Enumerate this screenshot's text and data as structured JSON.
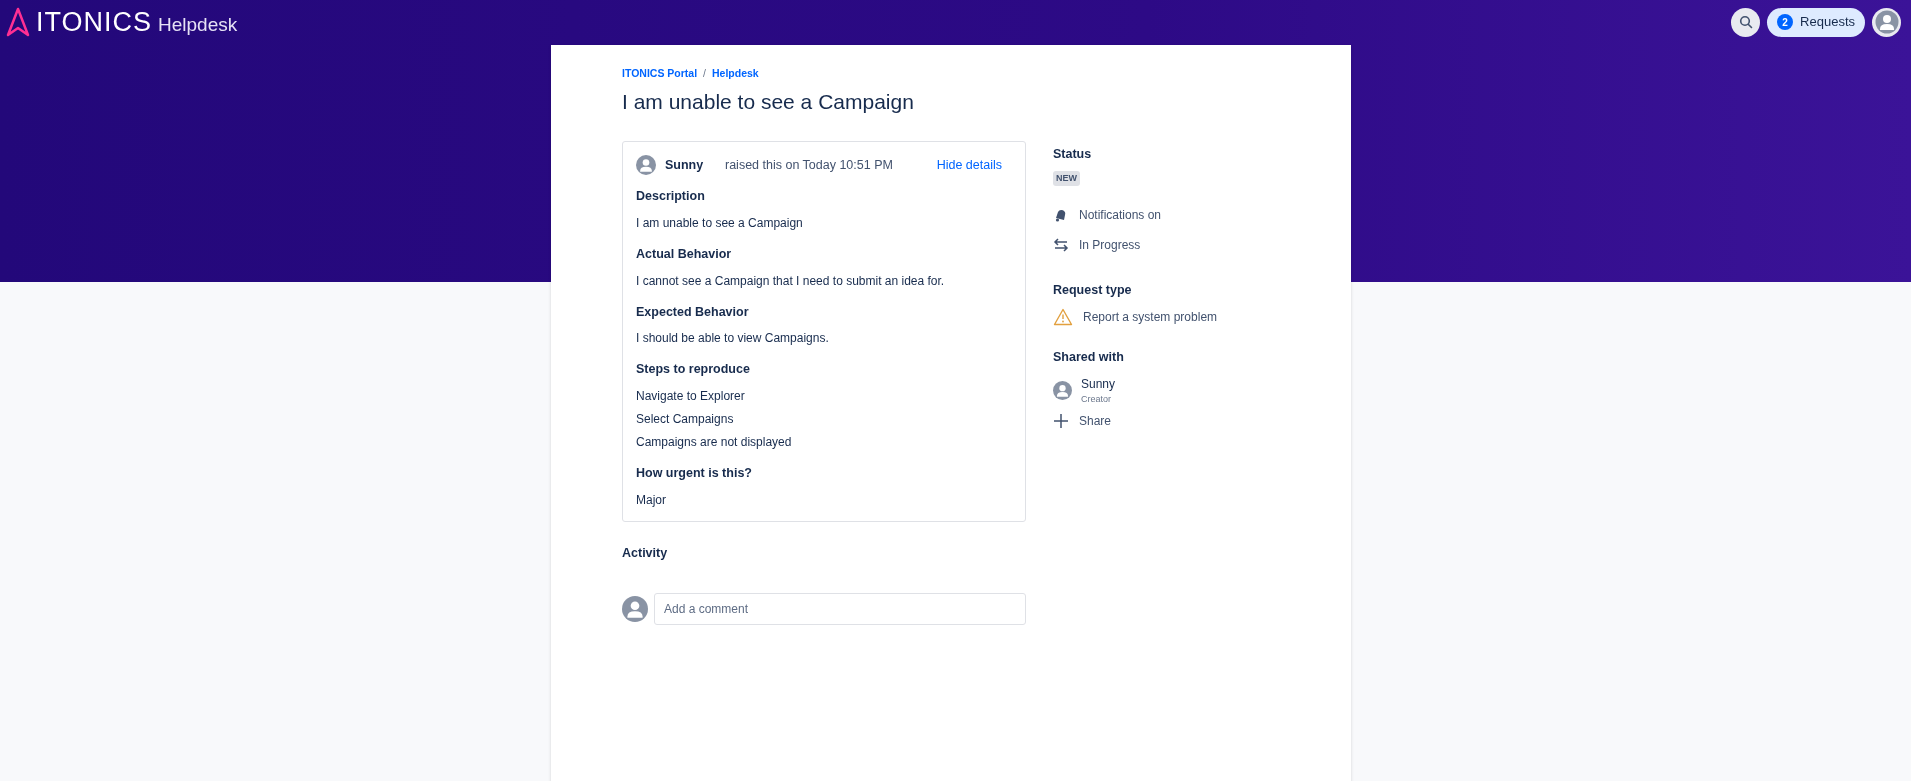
{
  "header": {
    "logo_text": "ITONICS",
    "logo_subtitle": "Helpdesk",
    "requests_count": "2",
    "requests_label": "Requests"
  },
  "breadcrumbs": [
    {
      "label": "ITONICS Portal"
    },
    {
      "label": "Helpdesk"
    }
  ],
  "breadcrumb_separator": "/",
  "title": "I am unable to see a Campaign",
  "details": {
    "author": "Sunny",
    "raised": "raised this on Today 10:51 PM",
    "toggle": "Hide details",
    "fields": [
      {
        "label": "Description",
        "lines": [
          "I am unable to see a Campaign"
        ]
      },
      {
        "label": "Actual Behavior",
        "lines": [
          "I cannot see a Campaign that I need to submit an idea for."
        ]
      },
      {
        "label": "Expected Behavior",
        "lines": [
          "I should be able to view Campaigns."
        ]
      },
      {
        "label": "Steps to reproduce",
        "lines": [
          "Navigate to Explorer",
          "Select Campaigns",
          "Campaigns are not displayed"
        ]
      },
      {
        "label": "How urgent is this?",
        "lines": [
          "Major"
        ]
      }
    ]
  },
  "activity": {
    "heading": "Activity",
    "comment_placeholder": "Add a comment"
  },
  "sidebar": {
    "status_heading": "Status",
    "status": "NEW",
    "actions": [
      {
        "kind": "bell",
        "label": "Notifications on"
      },
      {
        "kind": "transition",
        "label": "In Progress"
      }
    ],
    "request_type_heading": "Request type",
    "request_type": "Report a system problem",
    "shared_heading": "Shared with",
    "shared": [
      {
        "name": "Sunny",
        "role": "Creator"
      }
    ],
    "share_label": "Share"
  }
}
